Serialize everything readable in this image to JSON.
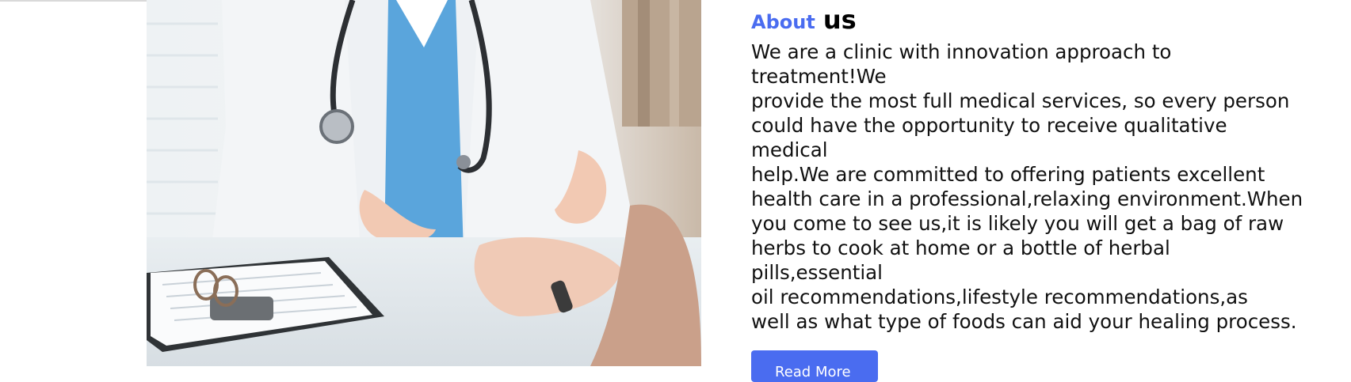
{
  "about": {
    "heading_accent": "About",
    "heading_main": "us",
    "lines": [
      "We are a clinic with innovation approach to",
      "treatment!We",
      "provide the most full medical services, so every person",
      "could have the opportunity to receive qualitative",
      "medical",
      "help.We are committed to offering patients excellent",
      "health care in a professional,relaxing environment.When",
      "you come to see us,it is likely you will get a bag of raw",
      "herbs to cook at home or a bottle of herbal",
      "pills,essential",
      "oil recommendations,lifestyle recommendations,as",
      "well as what type of foods can aid your healing process."
    ],
    "button_label": "Read More"
  },
  "colors": {
    "accent": "#4a6cf0",
    "text": "#111111"
  }
}
